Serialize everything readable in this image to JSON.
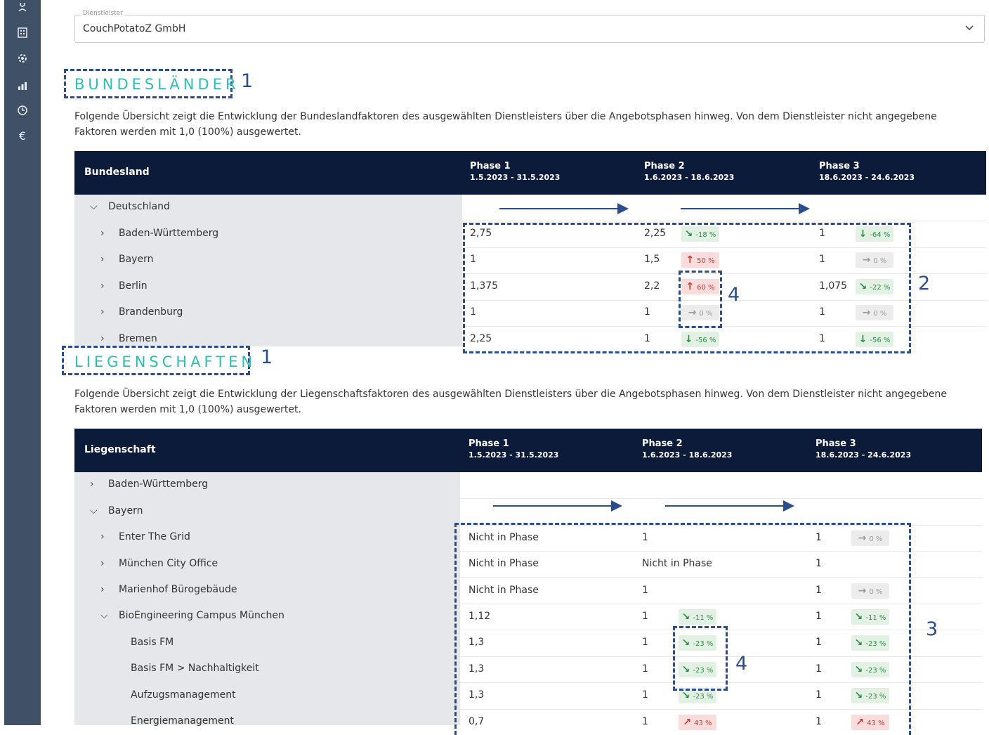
{
  "sidebar": {
    "icons": [
      "user-icon",
      "building-icon",
      "gear-icon",
      "chart-icon",
      "clock-icon",
      "euro-icon"
    ],
    "euro_glyph": "€"
  },
  "provider": {
    "legend": "Dienstleister",
    "value": "CouchPotatoZ GmbH"
  },
  "bundeslaender": {
    "title": "BUNDESLÄNDER",
    "description_line1": "Folgende Übersicht zeigt die Entwicklung der Bundeslandfaktoren des ausgewählten Dienstleisters über die Angebotsphasen hinweg. Von dem Dienstleister nicht angegebene",
    "description_line2": "Faktoren werden mit 1,0 (100%) ausgewertet.",
    "col_header": "Bundesland",
    "phases": [
      {
        "label": "Phase 1",
        "dates": "1.5.2023 - 31.5.2023"
      },
      {
        "label": "Phase 2",
        "dates": "1.6.2023 - 18.6.2023"
      },
      {
        "label": "Phase 3",
        "dates": "18.6.2023 - 24.6.2023"
      }
    ],
    "group": "Deutschland",
    "rows": [
      {
        "name": "Baden-Württemberg",
        "p1": "2,75",
        "p2": "2,25",
        "b2": "-18 %",
        "b2i": "↘",
        "p3": "1",
        "b3": "-64 %",
        "b3i": "↓"
      },
      {
        "name": "Bayern",
        "p1": "1",
        "p2": "1,5",
        "b2": "50 %",
        "b2i": "↑",
        "p3": "1",
        "b3": "0 %",
        "b3i": "→"
      },
      {
        "name": "Berlin",
        "p1": "1,375",
        "p2": "2,2",
        "b2": "60 %",
        "b2i": "↑",
        "p3": "1,075",
        "b3": "-22 %",
        "b3i": "↘"
      },
      {
        "name": "Brandenburg",
        "p1": "1",
        "p2": "1",
        "b2": "0 %",
        "b2i": "→",
        "p3": "1",
        "b3": "0 %",
        "b3i": "→"
      },
      {
        "name": "Bremen",
        "p1": "2,25",
        "p2": "1",
        "b2": "-56 %",
        "b2i": "↓",
        "p3": "1",
        "b3": "-56 %",
        "b3i": "↓"
      }
    ]
  },
  "liegenschaften": {
    "title": "LIEGENSCHAFTEN",
    "description_line1": "Folgende Übersicht zeigt die Entwicklung der Liegenschaftsfaktoren des ausgewählten Dienstleisters über die Angebotsphasen hinweg. Von dem Dienstleister nicht angegebene",
    "description_line2": "Faktoren werden mit 1,0 (100%) ausgewertet.",
    "col_header": "Liegenschaft",
    "phases": [
      {
        "label": "Phase 1",
        "dates": "1.5.2023 - 31.5.2023"
      },
      {
        "label": "Phase 2",
        "dates": "1.6.2023 - 18.6.2023"
      },
      {
        "label": "Phase 3",
        "dates": "18.6.2023 - 24.6.2023"
      }
    ],
    "tree": [
      {
        "name": "Baden-Württemberg"
      },
      {
        "name": "Bayern"
      },
      {
        "name": "Enter The Grid",
        "p1": "Nicht in Phase",
        "p2": "1",
        "p3": "1",
        "b3": "0 %",
        "b3i": "→"
      },
      {
        "name": "München City Office",
        "p1": "Nicht in Phase",
        "p2": "Nicht in Phase",
        "p3": "1"
      },
      {
        "name": "Marienhof Bürogebäude",
        "p1": "Nicht in Phase",
        "p2": "1",
        "p3": "1",
        "b3": "0 %",
        "b3i": "→"
      },
      {
        "name": "BioEngineering Campus München",
        "p1": "1,12",
        "p2": "1",
        "b2": "-11 %",
        "b2i": "↘",
        "p3": "1",
        "b3": "-11 %",
        "b3i": "↘"
      },
      {
        "name": "Basis FM",
        "p1": "1,3",
        "p2": "1",
        "b2": "-23 %",
        "b2i": "↘",
        "p3": "1",
        "b3": "-23 %",
        "b3i": "↘"
      },
      {
        "name": "Basis FM > Nachhaltigkeit",
        "p1": "1,3",
        "p2": "1",
        "b2": "-23 %",
        "b2i": "↘",
        "p3": "1",
        "b3": "-23 %",
        "b3i": "↘"
      },
      {
        "name": "Aufzugsmanagement",
        "p1": "1,3",
        "p2": "1",
        "b2": "-23 %",
        "b2i": "↘",
        "p3": "1",
        "b3": "-23 %",
        "b3i": "↘"
      },
      {
        "name": "Energiemanagement",
        "p1": "0,7",
        "p2": "1",
        "b2": "43 %",
        "b2i": "↗",
        "p3": "1",
        "b3": "43 %",
        "b3i": "↗"
      }
    ]
  },
  "annotations": {
    "n1": "1",
    "n2": "2",
    "n3": "3",
    "n4": "4"
  }
}
